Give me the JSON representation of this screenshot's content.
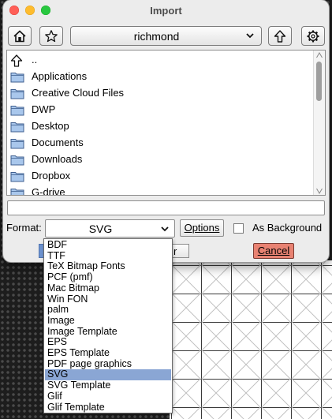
{
  "window": {
    "title": "Import"
  },
  "toolbar": {
    "home_icon": "home-icon",
    "bookmark_icon": "star-icon",
    "directory": "richmond",
    "up_icon": "up-arrow-icon",
    "config_icon": "gear-icon"
  },
  "files": [
    {
      "name": "..",
      "icon": "up-arrow-icon"
    },
    {
      "name": "Applications",
      "icon": "folder-icon"
    },
    {
      "name": "Creative Cloud Files",
      "icon": "folder-icon"
    },
    {
      "name": "DWP",
      "icon": "folder-icon"
    },
    {
      "name": "Desktop",
      "icon": "folder-icon"
    },
    {
      "name": "Documents",
      "icon": "folder-icon"
    },
    {
      "name": "Downloads",
      "icon": "folder-icon"
    },
    {
      "name": "Dropbox",
      "icon": "folder-icon"
    },
    {
      "name": "G-drive",
      "icon": "folder-icon"
    }
  ],
  "filename": {
    "value": ""
  },
  "format": {
    "label": "Format:",
    "selected": "SVG",
    "options_button": "Options",
    "as_background_label": "As Background",
    "as_background_checked": false
  },
  "buttons": {
    "filter_fragment": "r",
    "cancel": "Cancel"
  },
  "dropdown": {
    "options": [
      "BDF",
      "TTF",
      "TeX Bitmap Fonts",
      "PCF (pmf)",
      "Mac Bitmap",
      "Win FON",
      "palm",
      "Image",
      "Image Template",
      "EPS",
      "EPS Template",
      "PDF page graphics",
      "SVG",
      "SVG Template",
      "Glif",
      "Glif Template"
    ],
    "selected_index": 12
  },
  "colors": {
    "selection": "#8aa6d4",
    "cancel": "#e88272",
    "folder": "#a9c7ec"
  }
}
